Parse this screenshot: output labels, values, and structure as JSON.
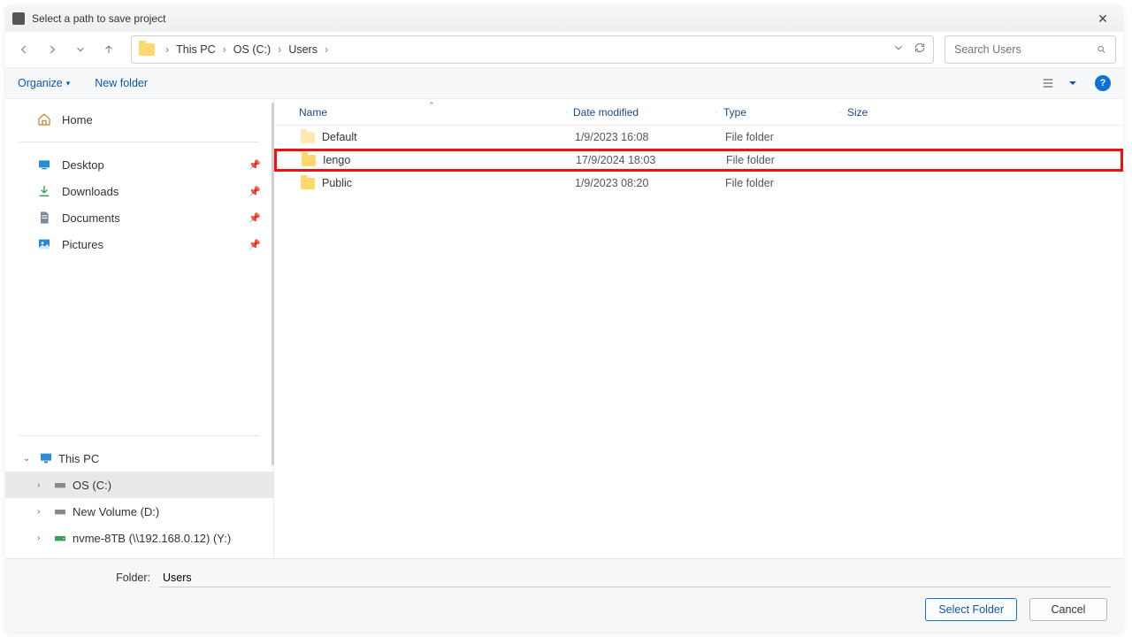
{
  "window": {
    "title": "Select a path to save project"
  },
  "breadcrumbs": [
    "This PC",
    "OS (C:)",
    "Users"
  ],
  "search": {
    "placeholder": "Search Users"
  },
  "commandbar": {
    "organize": "Organize",
    "newfolder": "New folder"
  },
  "sidebar": {
    "home": "Home",
    "quick": [
      {
        "label": "Desktop"
      },
      {
        "label": "Downloads"
      },
      {
        "label": "Documents"
      },
      {
        "label": "Pictures"
      }
    ],
    "thispc": "This PC",
    "drives": [
      {
        "label": "OS (C:)",
        "selected": true
      },
      {
        "label": "New Volume (D:)",
        "selected": false
      },
      {
        "label": "nvme-8TB (\\\\192.168.0.12) (Y:)",
        "selected": false
      }
    ]
  },
  "columns": {
    "name": "Name",
    "date": "Date modified",
    "type": "Type",
    "size": "Size"
  },
  "rows": [
    {
      "name": "Default",
      "date": "1/9/2023 16:08",
      "type": "File folder",
      "size": "",
      "highlight": false,
      "dim": true
    },
    {
      "name": "Iengo",
      "date": "17/9/2024 18:03",
      "type": "File folder",
      "size": "",
      "highlight": true,
      "dim": false
    },
    {
      "name": "Public",
      "date": "1/9/2023 08:20",
      "type": "File folder",
      "size": "",
      "highlight": false,
      "dim": false
    }
  ],
  "footer": {
    "folder_label": "Folder:",
    "folder_value": "Users",
    "select": "Select Folder",
    "cancel": "Cancel"
  }
}
